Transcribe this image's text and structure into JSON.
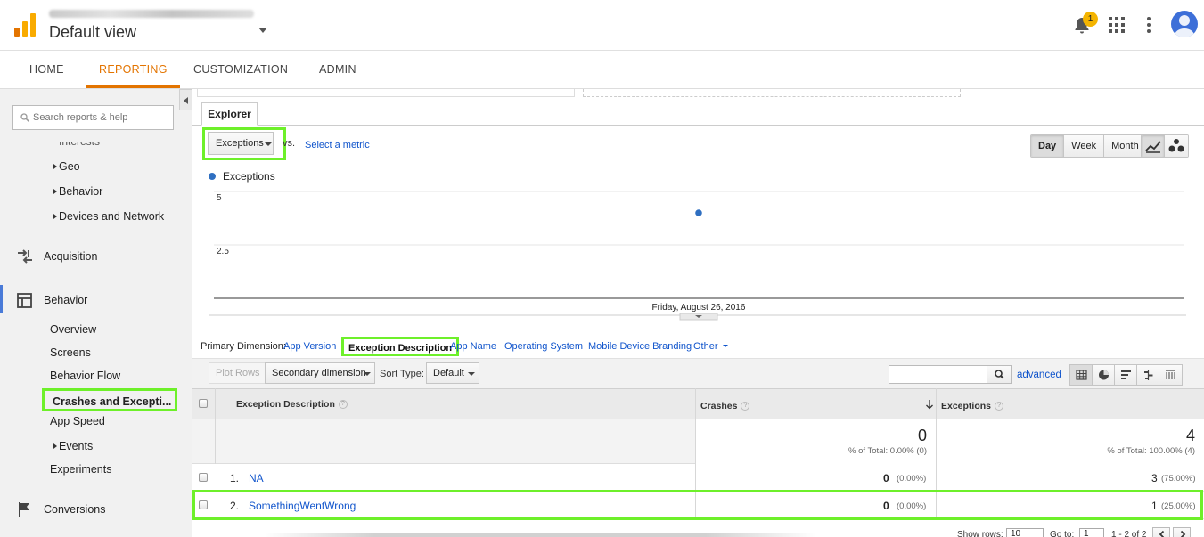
{
  "header": {
    "view_name": "Default view",
    "notification_count": "1"
  },
  "nav": {
    "tabs": [
      {
        "label": "HOME"
      },
      {
        "label": "REPORTING"
      },
      {
        "label": "CUSTOMIZATION"
      },
      {
        "label": "ADMIN"
      }
    ],
    "active": "REPORTING"
  },
  "sidebar": {
    "search_placeholder": "Search reports & help",
    "cut_item": "Interests",
    "audience_items": [
      {
        "label": "Geo"
      },
      {
        "label": "Behavior"
      },
      {
        "label": "Devices and Network"
      }
    ],
    "sections": {
      "acquisition": "Acquisition",
      "behavior": "Behavior",
      "conversions": "Conversions"
    },
    "behavior_items": [
      {
        "label": "Overview"
      },
      {
        "label": "Screens"
      },
      {
        "label": "Behavior Flow"
      },
      {
        "label": "Crashes and Excepti..."
      },
      {
        "label": "App Speed"
      },
      {
        "label": "Events"
      },
      {
        "label": "Experiments"
      }
    ]
  },
  "explorer": {
    "tab_label": "Explorer",
    "metric": "Exceptions",
    "vs_label": "vs.",
    "select_metric": "Select a metric",
    "time_buttons": [
      {
        "label": "Day",
        "active": true
      },
      {
        "label": "Week",
        "active": false
      },
      {
        "label": "Month",
        "active": false
      }
    ],
    "legend_label": "Exceptions"
  },
  "chart_data": {
    "type": "scatter",
    "series": [
      {
        "name": "Exceptions",
        "color": "#2f6fc1",
        "points": [
          {
            "x": "Friday, August 26, 2016",
            "y": 4
          }
        ]
      }
    ],
    "ytick_labels": [
      "5",
      "2.5"
    ],
    "ylim": [
      0,
      5
    ],
    "xtick_label": "Friday, August 26, 2016",
    "grid": true
  },
  "dimensions": {
    "label": "Primary Dimension:",
    "links": [
      "App Version",
      "Exception Description",
      "App Name",
      "Operating System",
      "Mobile Device Branding",
      "Other"
    ],
    "active": "Exception Description"
  },
  "toolbar": {
    "plot_rows": "Plot Rows",
    "secondary_dimension": "Secondary dimension",
    "sort_type_label": "Sort Type:",
    "sort_type_value": "Default",
    "advanced": "advanced"
  },
  "table": {
    "columns": {
      "dimension": "Exception Description",
      "crashes": "Crashes",
      "exceptions": "Exceptions"
    },
    "totals": {
      "crashes": "0",
      "crashes_sub": "% of Total: 0.00% (0)",
      "exceptions": "4",
      "exceptions_sub": "% of Total: 100.00% (4)"
    },
    "rows": [
      {
        "num": "1.",
        "name": "NA",
        "crashes": "0",
        "crashes_pct": "(0.00%)",
        "exceptions": "3",
        "exceptions_pct": "(75.00%)"
      },
      {
        "num": "2.",
        "name": "SomethingWentWrong",
        "crashes": "0",
        "crashes_pct": "(0.00%)",
        "exceptions": "1",
        "exceptions_pct": "(25.00%)"
      }
    ]
  },
  "footer": {
    "show_rows_label": "Show rows:",
    "show_rows_value": "10",
    "goto_label": "Go to:",
    "goto_value": "1",
    "range": "1 - 2 of 2"
  }
}
